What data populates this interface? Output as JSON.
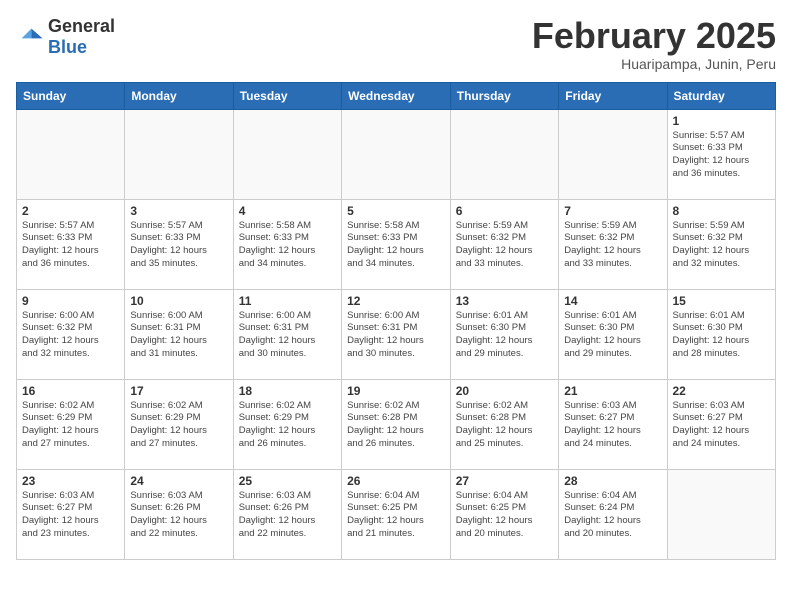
{
  "header": {
    "logo": {
      "general": "General",
      "blue": "Blue"
    },
    "month_title": "February 2025",
    "subtitle": "Huaripampa, Junin, Peru"
  },
  "weekdays": [
    "Sunday",
    "Monday",
    "Tuesday",
    "Wednesday",
    "Thursday",
    "Friday",
    "Saturday"
  ],
  "weeks": [
    [
      {
        "day": "",
        "info": ""
      },
      {
        "day": "",
        "info": ""
      },
      {
        "day": "",
        "info": ""
      },
      {
        "day": "",
        "info": ""
      },
      {
        "day": "",
        "info": ""
      },
      {
        "day": "",
        "info": ""
      },
      {
        "day": "1",
        "info": "Sunrise: 5:57 AM\nSunset: 6:33 PM\nDaylight: 12 hours\nand 36 minutes."
      }
    ],
    [
      {
        "day": "2",
        "info": "Sunrise: 5:57 AM\nSunset: 6:33 PM\nDaylight: 12 hours\nand 36 minutes."
      },
      {
        "day": "3",
        "info": "Sunrise: 5:57 AM\nSunset: 6:33 PM\nDaylight: 12 hours\nand 35 minutes."
      },
      {
        "day": "4",
        "info": "Sunrise: 5:58 AM\nSunset: 6:33 PM\nDaylight: 12 hours\nand 34 minutes."
      },
      {
        "day": "5",
        "info": "Sunrise: 5:58 AM\nSunset: 6:33 PM\nDaylight: 12 hours\nand 34 minutes."
      },
      {
        "day": "6",
        "info": "Sunrise: 5:59 AM\nSunset: 6:32 PM\nDaylight: 12 hours\nand 33 minutes."
      },
      {
        "day": "7",
        "info": "Sunrise: 5:59 AM\nSunset: 6:32 PM\nDaylight: 12 hours\nand 33 minutes."
      },
      {
        "day": "8",
        "info": "Sunrise: 5:59 AM\nSunset: 6:32 PM\nDaylight: 12 hours\nand 32 minutes."
      }
    ],
    [
      {
        "day": "9",
        "info": "Sunrise: 6:00 AM\nSunset: 6:32 PM\nDaylight: 12 hours\nand 32 minutes."
      },
      {
        "day": "10",
        "info": "Sunrise: 6:00 AM\nSunset: 6:31 PM\nDaylight: 12 hours\nand 31 minutes."
      },
      {
        "day": "11",
        "info": "Sunrise: 6:00 AM\nSunset: 6:31 PM\nDaylight: 12 hours\nand 30 minutes."
      },
      {
        "day": "12",
        "info": "Sunrise: 6:00 AM\nSunset: 6:31 PM\nDaylight: 12 hours\nand 30 minutes."
      },
      {
        "day": "13",
        "info": "Sunrise: 6:01 AM\nSunset: 6:30 PM\nDaylight: 12 hours\nand 29 minutes."
      },
      {
        "day": "14",
        "info": "Sunrise: 6:01 AM\nSunset: 6:30 PM\nDaylight: 12 hours\nand 29 minutes."
      },
      {
        "day": "15",
        "info": "Sunrise: 6:01 AM\nSunset: 6:30 PM\nDaylight: 12 hours\nand 28 minutes."
      }
    ],
    [
      {
        "day": "16",
        "info": "Sunrise: 6:02 AM\nSunset: 6:29 PM\nDaylight: 12 hours\nand 27 minutes."
      },
      {
        "day": "17",
        "info": "Sunrise: 6:02 AM\nSunset: 6:29 PM\nDaylight: 12 hours\nand 27 minutes."
      },
      {
        "day": "18",
        "info": "Sunrise: 6:02 AM\nSunset: 6:29 PM\nDaylight: 12 hours\nand 26 minutes."
      },
      {
        "day": "19",
        "info": "Sunrise: 6:02 AM\nSunset: 6:28 PM\nDaylight: 12 hours\nand 26 minutes."
      },
      {
        "day": "20",
        "info": "Sunrise: 6:02 AM\nSunset: 6:28 PM\nDaylight: 12 hours\nand 25 minutes."
      },
      {
        "day": "21",
        "info": "Sunrise: 6:03 AM\nSunset: 6:27 PM\nDaylight: 12 hours\nand 24 minutes."
      },
      {
        "day": "22",
        "info": "Sunrise: 6:03 AM\nSunset: 6:27 PM\nDaylight: 12 hours\nand 24 minutes."
      }
    ],
    [
      {
        "day": "23",
        "info": "Sunrise: 6:03 AM\nSunset: 6:27 PM\nDaylight: 12 hours\nand 23 minutes."
      },
      {
        "day": "24",
        "info": "Sunrise: 6:03 AM\nSunset: 6:26 PM\nDaylight: 12 hours\nand 22 minutes."
      },
      {
        "day": "25",
        "info": "Sunrise: 6:03 AM\nSunset: 6:26 PM\nDaylight: 12 hours\nand 22 minutes."
      },
      {
        "day": "26",
        "info": "Sunrise: 6:04 AM\nSunset: 6:25 PM\nDaylight: 12 hours\nand 21 minutes."
      },
      {
        "day": "27",
        "info": "Sunrise: 6:04 AM\nSunset: 6:25 PM\nDaylight: 12 hours\nand 20 minutes."
      },
      {
        "day": "28",
        "info": "Sunrise: 6:04 AM\nSunset: 6:24 PM\nDaylight: 12 hours\nand 20 minutes."
      },
      {
        "day": "",
        "info": ""
      }
    ]
  ]
}
